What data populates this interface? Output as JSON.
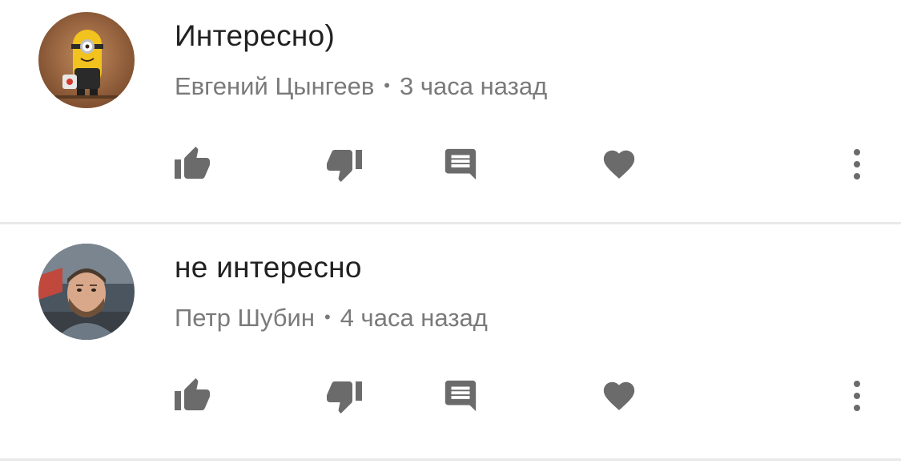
{
  "comments": [
    {
      "text": "Интересно)",
      "author": "Евгений Цынгеев",
      "separator": "•",
      "time": "3 часа назад",
      "avatar": "minion-avatar"
    },
    {
      "text": "не интересно",
      "author": "Петр Шубин",
      "separator": "•",
      "time": "4 часа назад",
      "avatar": "man-photo-avatar"
    }
  ],
  "icons": {
    "like": "thumbs-up-icon",
    "dislike": "thumbs-down-icon",
    "reply": "comment-icon",
    "heart": "heart-icon",
    "more": "more-vertical-icon"
  },
  "colors": {
    "text": "#212121",
    "meta": "#7a7a7a",
    "icon": "#6b6b6b",
    "divider": "#e9e9e9"
  }
}
